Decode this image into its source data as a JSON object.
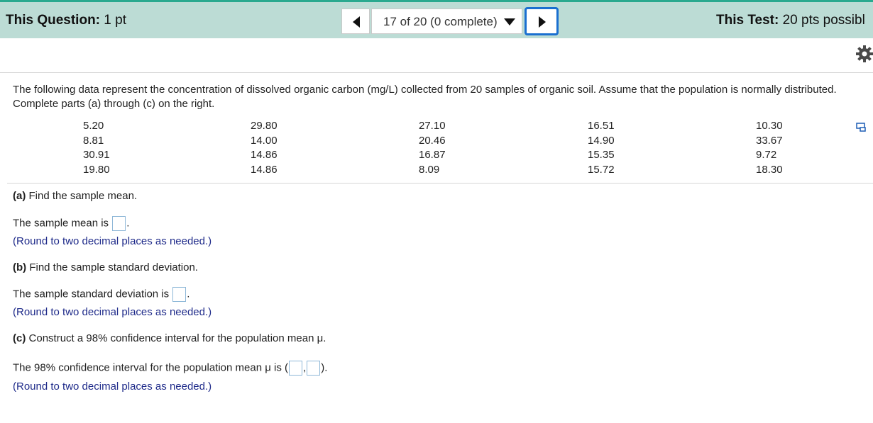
{
  "header": {
    "question_label": "This Question:",
    "question_value": "1 pt",
    "nav_status": "17 of 20 (0 complete)",
    "test_label": "This Test:",
    "test_value": "20 pts possibl"
  },
  "intro": "The following data represent the concentration of dissolved organic carbon (mg/L) collected from 20 samples of organic soil. Assume that the population is normally distributed. Complete parts (a) through (c) on the right.",
  "data_columns": [
    [
      "5.20",
      "8.81",
      "30.91",
      "19.80"
    ],
    [
      "29.80",
      "14.00",
      "14.86",
      "14.86"
    ],
    [
      "27.10",
      "20.46",
      "16.87",
      "8.09"
    ],
    [
      "16.51",
      "14.90",
      "15.35",
      "15.72"
    ],
    [
      "10.30",
      "33.67",
      "9.72",
      "18.30"
    ]
  ],
  "part_a": {
    "label": "(a)",
    "question": "Find the sample mean.",
    "answer_prefix": "The sample mean is",
    "answer_suffix": ".",
    "hint": "(Round to two decimal places as needed.)"
  },
  "part_b": {
    "label": "(b)",
    "question": "Find the sample standard deviation.",
    "answer_prefix": "The sample standard deviation is",
    "answer_suffix": ".",
    "hint": "(Round to two decimal places as needed.)"
  },
  "part_c": {
    "label": "(c)",
    "question": "Construct a 98% confidence interval for the population mean μ.",
    "answer_prefix": "The 98% confidence interval for the population mean μ is (",
    "answer_comma": ",",
    "answer_suffix": ").",
    "hint": "(Round to two decimal places as needed.)"
  }
}
